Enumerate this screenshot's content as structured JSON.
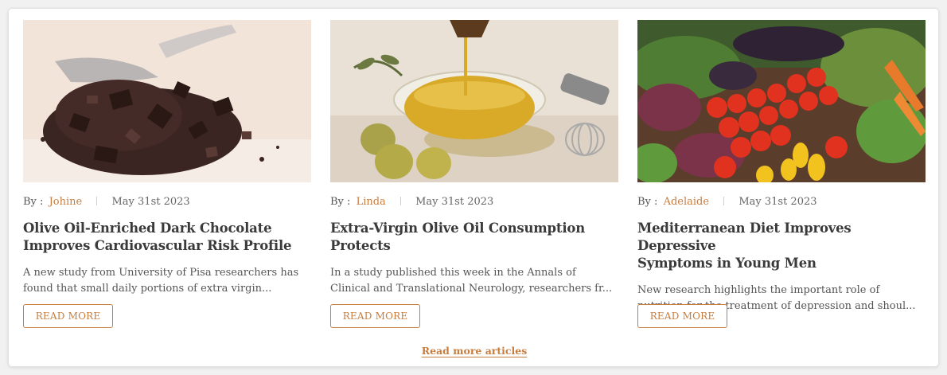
{
  "articles": [
    {
      "by_label": "By :",
      "author": "Johine",
      "date": "May 31st 2023",
      "title_line1": "Olive Oil-Enriched Dark Chocolate",
      "title_line2": "Improves Cardiovascular Risk Profile",
      "excerpt_line1": "A new study from University of Pisa researchers has",
      "excerpt_line2": "found that small daily portions of extra virgin...",
      "button_label": "READ MORE",
      "image": "dark-chocolate-photo"
    },
    {
      "by_label": "By :",
      "author": "Linda",
      "date": "May 31st 2023",
      "title_line1": "Extra-Virgin Olive Oil Consumption",
      "title_line2": "Protects",
      "excerpt_line1": "In a study published this week in the Annals of",
      "excerpt_line2": "Clinical and Translational Neurology, researchers fr...",
      "button_label": "READ MORE",
      "image": "olive-oil-photo"
    },
    {
      "by_label": "By :",
      "author": "Adelaide",
      "date": "May 31st 2023",
      "title_line1": "Mediterranean Diet Improves Depressive",
      "title_line2": "Symptoms in Young Men",
      "excerpt_line1": "New research highlights the important role of",
      "excerpt_line2": "nutrition for the treatment of depression and shoul...",
      "button_label": "READ MORE",
      "image": "vegetables-photo"
    }
  ],
  "more_link": "Read more articles",
  "colors": {
    "accent": "#c77d3e",
    "text": "#3a3a3a",
    "muted": "#555555"
  }
}
